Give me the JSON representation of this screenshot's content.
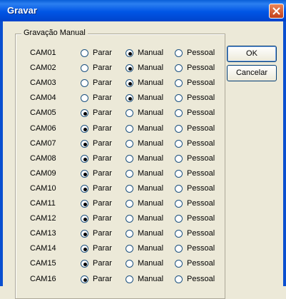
{
  "window": {
    "title": "Gravar"
  },
  "group": {
    "legend": "Gravação Manual"
  },
  "options": {
    "stop": "Parar",
    "manual": "Manual",
    "personal": "Pessoal"
  },
  "buttons": {
    "ok": "OK",
    "cancel": "Cancelar"
  },
  "cameras": [
    {
      "name": "CAM01",
      "selected": "manual"
    },
    {
      "name": "CAM02",
      "selected": "manual"
    },
    {
      "name": "CAM03",
      "selected": "manual"
    },
    {
      "name": "CAM04",
      "selected": "manual"
    },
    {
      "name": "CAM05",
      "selected": "stop"
    },
    {
      "name": "CAM06",
      "selected": "stop"
    },
    {
      "name": "CAM07",
      "selected": "stop"
    },
    {
      "name": "CAM08",
      "selected": "stop"
    },
    {
      "name": "CAM09",
      "selected": "stop"
    },
    {
      "name": "CAM10",
      "selected": "stop"
    },
    {
      "name": "CAM11",
      "selected": "stop"
    },
    {
      "name": "CAM12",
      "selected": "stop"
    },
    {
      "name": "CAM13",
      "selected": "stop"
    },
    {
      "name": "CAM14",
      "selected": "stop"
    },
    {
      "name": "CAM15",
      "selected": "stop"
    },
    {
      "name": "CAM16",
      "selected": "stop"
    }
  ]
}
